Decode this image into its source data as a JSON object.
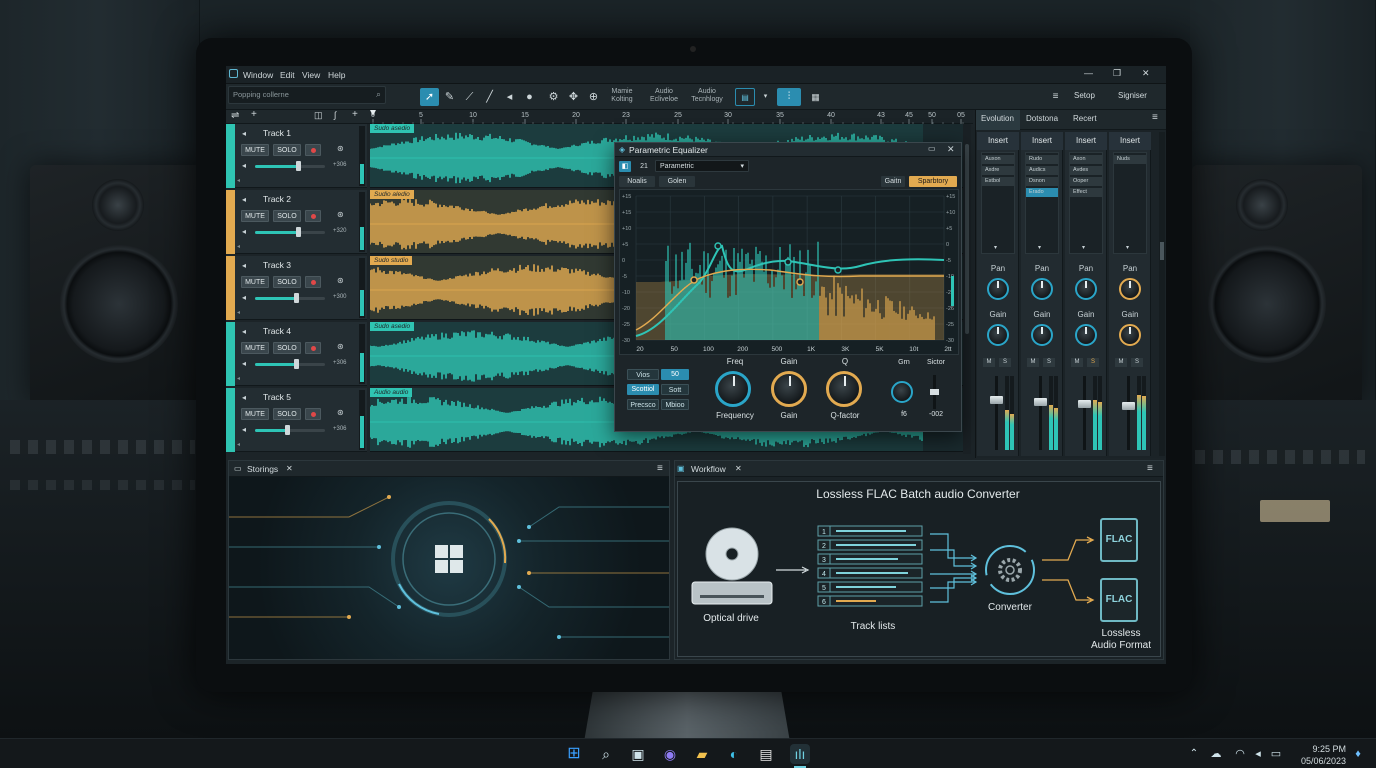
{
  "menu": {
    "icon": "app-icon",
    "items": [
      "Window",
      "Edit",
      "View",
      "Help"
    ]
  },
  "window_controls": {
    "minimize": "—",
    "maximize": "❐",
    "close": "✕"
  },
  "toolbar": {
    "search_placeholder": "Popping collerne",
    "tools": [
      "pointer-tool",
      "pencil-tool",
      "line-tool",
      "brush-tool",
      "speaker-tool",
      "solo-tool",
      "gear-tool",
      "crosshair-tool",
      "settings-tool"
    ],
    "labels": [
      [
        "Mamie",
        "Kolting"
      ],
      [
        "Audio",
        "Ecliveloe"
      ],
      [
        "Audio",
        "Tecnhlogy"
      ]
    ],
    "right": {
      "menu_icon": "≡",
      "setup": "Setop",
      "signier": "Signiser"
    }
  },
  "ruler": {
    "ticks": [
      "0",
      "5",
      "10",
      "15",
      "20",
      "23",
      "25",
      "30",
      "35",
      "40",
      "43",
      "45",
      "50",
      "05"
    ]
  },
  "tracks": [
    {
      "name": "Track 1",
      "mute": "MUTE",
      "solo": "SOLO",
      "db": "+306",
      "lane_label": "Sudo asedio",
      "color": "#2fc4b2",
      "volume": 0.62
    },
    {
      "name": "Track 2",
      "mute": "MUTE",
      "solo": "SOLO",
      "db": "+320",
      "lane_label": "Sudio aledio",
      "color": "#e2aa50",
      "volume": 0.62
    },
    {
      "name": "Track 3",
      "mute": "MUTE",
      "solo": "SOLO",
      "db": "+300",
      "lane_label": "Sudo studio",
      "color": "#e2aa50",
      "volume": 0.58
    },
    {
      "name": "Track 4",
      "mute": "MUTE",
      "solo": "SOLO",
      "db": "+306",
      "lane_label": "Sudo asedio",
      "color": "#2fc4b2",
      "volume": 0.58
    },
    {
      "name": "Track 5",
      "mute": "MUTE",
      "solo": "SOLO",
      "db": "+306",
      "lane_label": "Audio audio",
      "color": "#2fc4b2",
      "volume": 0.45
    }
  ],
  "eq": {
    "title": "Parametric Equalizer",
    "band_num": "21",
    "preset": "Parametric",
    "tabs": [
      "Noalis",
      "Golen"
    ],
    "right_tabs": [
      "Gaitn",
      "Sparbtory"
    ],
    "y_ticks_left": [
      "+15",
      "+15",
      "+10",
      "+5",
      "0",
      "-5",
      "-10",
      "-20",
      "-25",
      "-30"
    ],
    "y_ticks_right": [
      "+15",
      "+10",
      "+5",
      "0",
      "-5",
      "-10",
      "-26",
      "-26",
      "-25",
      "-30"
    ],
    "x_ticks": [
      "20",
      "50",
      "100",
      "200",
      "500",
      "1K",
      "3K",
      "5K",
      "10t",
      "2tt"
    ],
    "mode_buttons": [
      [
        "Vios",
        "50"
      ],
      [
        "Scottiol",
        "Sott"
      ],
      [
        "Precsco",
        "Mbioo"
      ]
    ],
    "knobs": [
      {
        "top": "Freq",
        "bottom": "Frequency",
        "ring": "#2aa5c8"
      },
      {
        "top": "Gain",
        "bottom": "Gain",
        "ring": "#e2aa50"
      },
      {
        "top": "Q",
        "bottom": "Q-factor",
        "ring": "#e2aa50"
      }
    ],
    "small_knob": {
      "top": "Grn",
      "bottom": "f6"
    },
    "fader": {
      "top": "Sictor",
      "bottom": "-002"
    }
  },
  "mixer": {
    "tabs": [
      "Evolution",
      "Dotstona",
      "Recert"
    ],
    "channels": [
      {
        "insert": "Insert",
        "slots": [
          "Auxon",
          "Axdre",
          "Estbol"
        ],
        "pan": "Pan",
        "gain": "Gain",
        "ring": "#2aa5c8"
      },
      {
        "insert": "Insert",
        "slots": [
          "Rudo",
          "Audics",
          "Dsnon",
          "Erado"
        ],
        "pan": "Pan",
        "gain": "Gain",
        "ring": "#2aa5c8"
      },
      {
        "insert": "Insert",
        "slots": [
          "Axon",
          "Avdes",
          "Ooper",
          "Effect"
        ],
        "pan": "Pan",
        "gain": "Gain",
        "ring": "#2aa5c8"
      },
      {
        "insert": "Insert",
        "slots": [
          "Nuds"
        ],
        "pan": "Pan",
        "gain": "Gain",
        "ring": "#e2aa50"
      }
    ],
    "ms": [
      "M",
      "S"
    ]
  },
  "storings": {
    "title": "Storings"
  },
  "workflow": {
    "title": "Workflow",
    "heading": "Lossless FLAC Batch audio Converter",
    "optical": "Optical drive",
    "track_lists": "Track lists",
    "track_numbers": [
      "1",
      "2",
      "3",
      "4",
      "5",
      "6"
    ],
    "converter": "Converter",
    "flac": "FLAC",
    "format": [
      "Lossless",
      "Audio Format"
    ]
  },
  "taskbar": {
    "time": "9:25 PM",
    "date": "05/06/2023"
  },
  "colors": {
    "teal": "#2fc4b2",
    "amber": "#e2aa50",
    "accent": "#2b8db0"
  }
}
